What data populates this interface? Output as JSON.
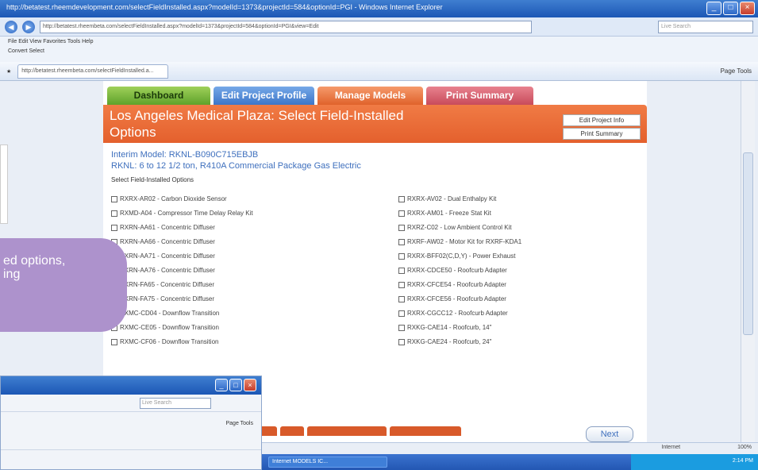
{
  "browser": {
    "title": "http://betatest.rheemdevelopment.com/selectFieldInstalled.aspx?modelId=1373&projectId=584&optionId=PGI - Windows Internet Explorer",
    "url": "http://betatest.rheembeta.com/selectFieldInstalled.aspx?modelId=1373&projectId=584&optionId=PGI&view=Edit",
    "search_placeholder": "Live Search",
    "menu": "File Edit View Favorites Tools Help",
    "toolbar2": "Convert  Select",
    "tab_label": "http://betatest.rheembeta.com/selectFieldInstalled.a...",
    "tools": "Page  Tools",
    "zoom": "100%",
    "internet": "Internet"
  },
  "app": {
    "tabs": [
      "Dashboard",
      "Edit Project Profile",
      "Manage Models",
      "Print Summary"
    ],
    "page_title": "Los Angeles Medical Plaza: Select Field-Installed Options",
    "edit_project_info": "Edit Project Info",
    "print_summary_btn": "Print Summary",
    "interim_model": "Interim Model: RKNL-B090C715EBJB",
    "model_desc": "RKNL: 6 to 12 1/2 ton, R410A Commercial Package Gas Electric",
    "select_label": "Select Field-Installed Options",
    "left_options": [
      "RXRX-AR02 - Carbon Dioxide Sensor",
      "RXMD-A04 - Compressor Time Delay Relay Kit",
      "RXRN-AA61 - Concentric Diffuser",
      "RXRN-AA66 - Concentric Diffuser",
      "RXRN-AA71 - Concentric Diffuser",
      "RXRN-AA76 - Concentric Diffuser",
      "RXRN-FA65 - Concentric Diffuser",
      "RXRN-FA75 - Concentric Diffuser",
      "RXMC-CD04 - Downflow Transition",
      "RXMC-CE05 - Downflow Transition",
      "RXMC-CF06 - Downflow Transition"
    ],
    "right_options": [
      "RXRX-AV02 - Dual Enthalpy Kit",
      "RXRX-AM01 - Freeze Stat Kit",
      "RXRZ-C02 - Low Ambient Control Kit",
      "RXRF-AW02 - Motor Kit for RXRF-KDA1",
      "RXRX-BFF02(C,D,Y) - Power Exhaust",
      "RXRX-CDCE50 - Roofcurb Adapter",
      "RXRX-CFCE54 - Roofcurb Adapter",
      "RXRX-CFCE56 - Roofcurb Adapter",
      "RXRX-CGCC12 - Roofcurb Adapter",
      "RXKG-CAE14 - Roofcurb, 14\"",
      "RXKG-CAE24 - Roofcurb, 24\""
    ],
    "next": "Next"
  },
  "callout": {
    "line1": "ed options,",
    "line2": "ing"
  },
  "taskbar": {
    "item": "Internet MODELS IC...",
    "clock": "2:14 PM"
  },
  "window2": {
    "search": "Live Search",
    "tools": "Page  Tools"
  }
}
